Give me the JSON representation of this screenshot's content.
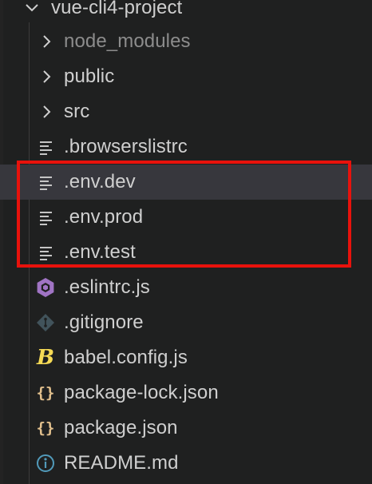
{
  "explorer": {
    "root_folder": "vue-cli4-project",
    "items": [
      {
        "label": "node_modules",
        "kind": "folder",
        "icon": "chevron-right-icon",
        "dimmed": true
      },
      {
        "label": "public",
        "kind": "folder",
        "icon": "chevron-right-icon"
      },
      {
        "label": "src",
        "kind": "folder",
        "icon": "chevron-right-icon"
      },
      {
        "label": ".browserslistrc",
        "kind": "file",
        "icon": "text-file-icon"
      },
      {
        "label": ".env.dev",
        "kind": "file",
        "icon": "text-file-icon",
        "selected": true
      },
      {
        "label": ".env.prod",
        "kind": "file",
        "icon": "text-file-icon"
      },
      {
        "label": ".env.test",
        "kind": "file",
        "icon": "text-file-icon"
      },
      {
        "label": ".eslintrc.js",
        "kind": "file",
        "icon": "eslint-icon"
      },
      {
        "label": ".gitignore",
        "kind": "file",
        "icon": "git-icon"
      },
      {
        "label": "babel.config.js",
        "kind": "file",
        "icon": "babel-icon"
      },
      {
        "label": "package-lock.json",
        "kind": "file",
        "icon": "json-braces-icon"
      },
      {
        "label": "package.json",
        "kind": "file",
        "icon": "json-braces-icon"
      },
      {
        "label": "README.md",
        "kind": "file",
        "icon": "info-icon"
      }
    ],
    "icon_glyphs": {
      "json": "{}",
      "babel": "B"
    },
    "colors": {
      "highlight_box": "#e8120c",
      "selected_row": "#37373d",
      "json_icon": "#e2c08d",
      "babel_icon": "#f5da55",
      "eslint_icon": "#a074c4",
      "info_icon": "#519aba",
      "git_icon": "#41535b"
    }
  }
}
